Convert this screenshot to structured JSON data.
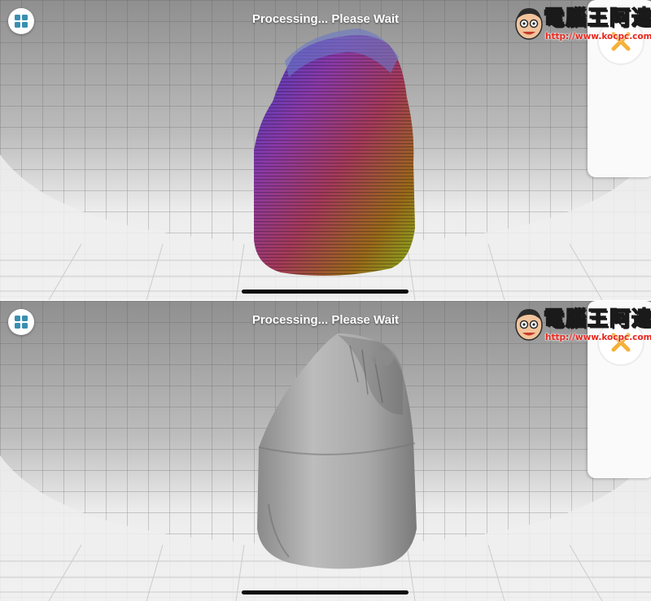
{
  "screens": [
    {
      "status_text": "Processing... Please Wait",
      "model_view": "colored voxel point cloud",
      "icons": {
        "menu": "grid-icon",
        "close": "close-icon"
      }
    },
    {
      "status_text": "Processing... Please Wait",
      "model_view": "grey mesh",
      "icons": {
        "menu": "grid-icon",
        "close": "close-icon"
      }
    }
  ],
  "watermark": {
    "title": "電腦王阿達",
    "url": "http://www.kocpc.com.tw"
  },
  "colors": {
    "accent": "#3a8fb0",
    "close_x": "#f5b13a",
    "grid_floor": "#ececec",
    "sky": "#9a9a9a"
  }
}
